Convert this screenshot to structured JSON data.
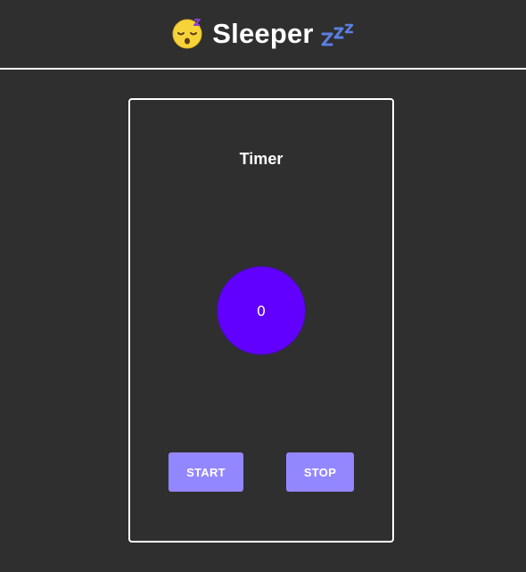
{
  "header": {
    "title": "Sleeper",
    "leading_icon": "sleeping-face-icon",
    "trailing_icon": "zzz-icon"
  },
  "timer_card": {
    "title": "Timer",
    "count": "0",
    "start_label": "START",
    "stop_label": "STOP"
  },
  "colors": {
    "background": "#2f2f2f",
    "circle": "#6200ff",
    "button": "#9387ff",
    "text": "#ffffff"
  }
}
